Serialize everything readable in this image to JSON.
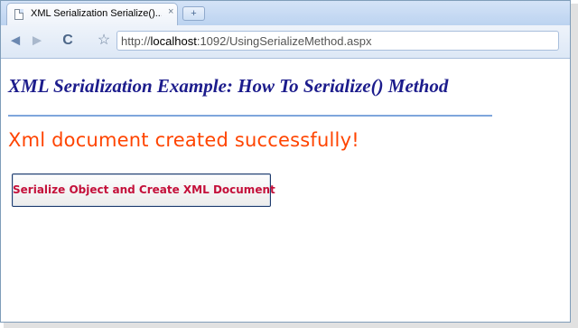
{
  "browser": {
    "tab_title": "XML Serialization Serialize()...",
    "tab_close": "×",
    "new_tab": "+",
    "url_prefix": "http://",
    "url_host": "localhost",
    "url_path": ":1092/UsingSerializeMethod.aspx",
    "back_icon": "◄",
    "forward_icon": "►",
    "reload_icon": "C",
    "star_icon": "☆"
  },
  "page": {
    "heading": "XML Serialization Example: How To Serialize() Method",
    "status_message": "Xml document created successfully!",
    "button_label": "Serialize Object and Create XML Document"
  },
  "colors": {
    "heading": "#1c1c8c",
    "status": "#ff4400",
    "button_text": "#c4103a",
    "rule": "#7ea6dc"
  }
}
